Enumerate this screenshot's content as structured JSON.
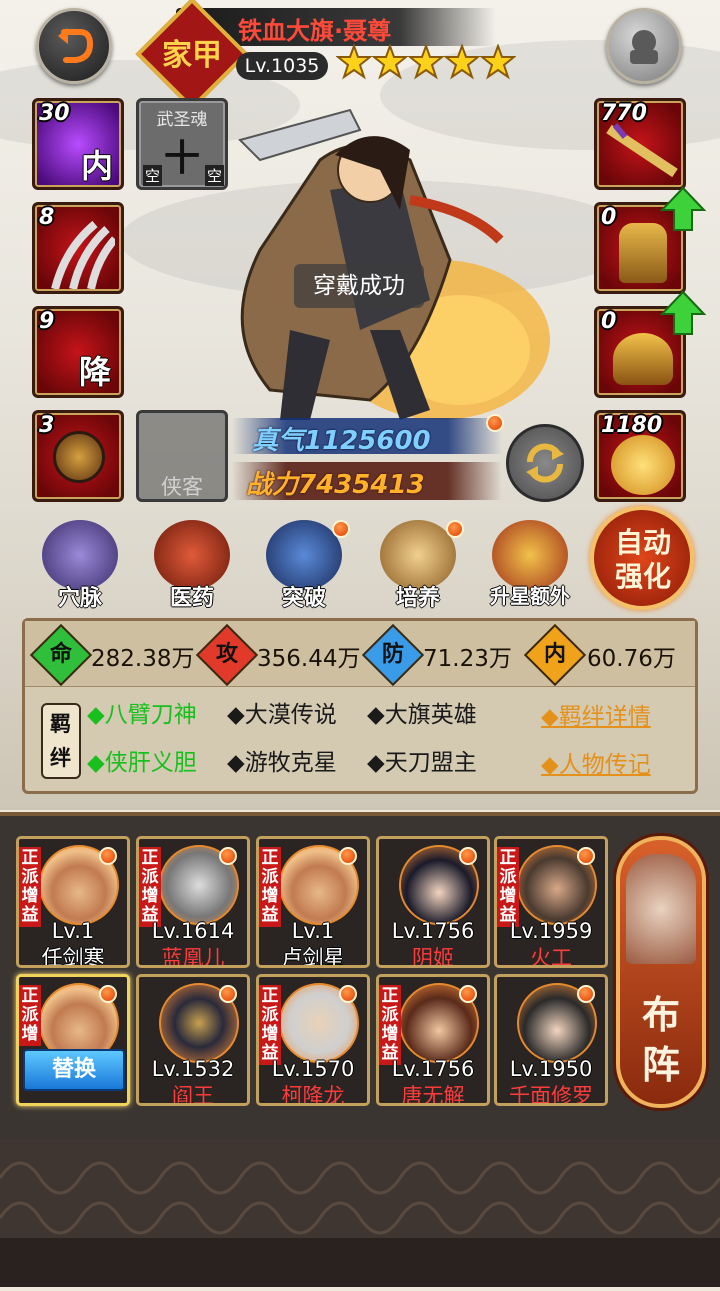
{
  "header": {
    "hero_title": "铁血大旗·聂尊",
    "badge_text": "家甲",
    "level": "Lv.1035",
    "stars": 5
  },
  "left_slots": [
    {
      "count": "30",
      "glyph": "内",
      "color": "purple"
    },
    {
      "count": "",
      "label": "武圣魂",
      "glyph": "十",
      "sub_left": "空",
      "sub_right": "空",
      "color": "gray"
    },
    {
      "count": "8",
      "glyph": "",
      "color": "red"
    },
    {
      "count": "9",
      "glyph": "降",
      "color": "red"
    },
    {
      "count": "3",
      "glyph": "",
      "color": "red"
    },
    {
      "count": "",
      "label": "侠客",
      "color": "empty"
    }
  ],
  "right_slots": [
    {
      "count": "770"
    },
    {
      "count": "0"
    },
    {
      "count": "0"
    },
    {
      "count": "1180"
    }
  ],
  "toast": "穿戴成功",
  "zhenqi": "真气1125600",
  "power": "战力7435413",
  "actions": [
    {
      "label": "穴脉",
      "icon": "meridian-icon",
      "dot": false
    },
    {
      "label": "医药",
      "icon": "medicine-icon",
      "dot": false
    },
    {
      "label": "突破",
      "icon": "breakthrough-icon",
      "dot": true
    },
    {
      "label": "培养",
      "icon": "train-icon",
      "dot": true
    },
    {
      "label": "升星额外",
      "icon": "star-up-icon",
      "dot": false
    }
  ],
  "auto_strengthen": "自动强化",
  "stats": [
    {
      "icon": "命",
      "value": "282.38万",
      "color": "#2fbf3b"
    },
    {
      "icon": "攻",
      "value": "356.44万",
      "color": "#e23a2a"
    },
    {
      "icon": "防",
      "value": "71.23万",
      "color": "#3a9be8"
    },
    {
      "icon": "内",
      "value": "60.76万",
      "color": "#f0a21a"
    }
  ],
  "bond_label": "羁绊",
  "bonds_row1": [
    {
      "text": "◆八臂刀神",
      "active": true
    },
    {
      "text": "◆大漠传说",
      "active": false
    },
    {
      "text": "◆大旗英雄",
      "active": false
    }
  ],
  "bonds_row2": [
    {
      "text": "◆侠肝义胆",
      "active": true
    },
    {
      "text": "◆游牧克星",
      "active": false
    },
    {
      "text": "◆天刀盟主",
      "active": false
    }
  ],
  "bond_detail": "◆羁绊详情",
  "biography": "◆人物传记",
  "heroes_row1": [
    {
      "level": "Lv.1",
      "name": "任剑寒",
      "name_color": "#ffffff",
      "tag": "正派增益"
    },
    {
      "level": "Lv.1614",
      "name": "蓝凰儿",
      "name_color": "#ff3b3b",
      "tag": "正派增益"
    },
    {
      "level": "Lv.1",
      "name": "卢剑星",
      "name_color": "#ffffff",
      "tag": "正派增益"
    },
    {
      "level": "Lv.1756",
      "name": "阴姬",
      "name_color": "#ff3b3b",
      "tag": ""
    },
    {
      "level": "Lv.1959",
      "name": "火工",
      "name_color": "#ff3b3b",
      "tag": "正派增益"
    }
  ],
  "heroes_row2": [
    {
      "level": "",
      "name": "",
      "name_color": "#ffffff",
      "tag": "正派增"
    },
    {
      "level": "Lv.1532",
      "name": "阎王",
      "name_color": "#ff3b3b",
      "tag": ""
    },
    {
      "level": "Lv.1570",
      "name": "柯降龙",
      "name_color": "#ff3b3b",
      "tag": "正派增益"
    },
    {
      "level": "Lv.1756",
      "name": "唐无解",
      "name_color": "#ff3b3b",
      "tag": "正派增益"
    },
    {
      "level": "Lv.1950",
      "name": "千面修罗",
      "name_color": "#ff3b3b",
      "tag": ""
    }
  ],
  "replace_button": "替换",
  "formation_button": "布阵"
}
